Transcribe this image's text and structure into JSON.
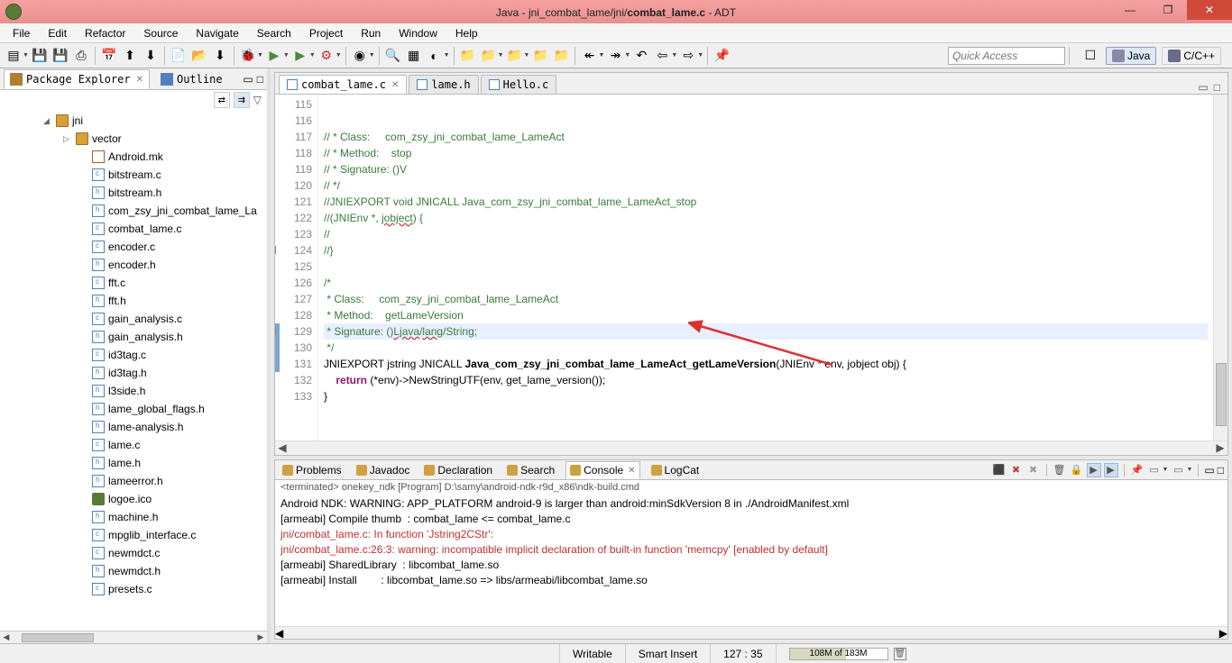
{
  "titlebar": {
    "title_prefix": "Java - jni_combat_lame/jni/",
    "title_file": "combat_lame.c",
    "title_suffix": " - ADT"
  },
  "menubar": [
    "File",
    "Edit",
    "Refactor",
    "Source",
    "Navigate",
    "Search",
    "Project",
    "Run",
    "Window",
    "Help"
  ],
  "toolbar": {
    "quick_access_placeholder": "Quick Access"
  },
  "perspectives": [
    {
      "label": "Java"
    },
    {
      "label": "C/C++"
    }
  ],
  "sidebar": {
    "tabs": [
      {
        "label": "Package Explorer",
        "active": true
      },
      {
        "label": "Outline",
        "active": false
      }
    ],
    "tree": {
      "root": "jni",
      "sub": "vector",
      "files": [
        {
          "name": "Android.mk",
          "type": "mk"
        },
        {
          "name": "bitstream.c",
          "type": "c"
        },
        {
          "name": "bitstream.h",
          "type": "h"
        },
        {
          "name": "com_zsy_jni_combat_lame_La",
          "type": "h"
        },
        {
          "name": "combat_lame.c",
          "type": "c"
        },
        {
          "name": "encoder.c",
          "type": "c"
        },
        {
          "name": "encoder.h",
          "type": "h"
        },
        {
          "name": "fft.c",
          "type": "c"
        },
        {
          "name": "fft.h",
          "type": "h"
        },
        {
          "name": "gain_analysis.c",
          "type": "c"
        },
        {
          "name": "gain_analysis.h",
          "type": "h"
        },
        {
          "name": "id3tag.c",
          "type": "c"
        },
        {
          "name": "id3tag.h",
          "type": "h"
        },
        {
          "name": "l3side.h",
          "type": "h"
        },
        {
          "name": "lame_global_flags.h",
          "type": "h"
        },
        {
          "name": "lame-analysis.h",
          "type": "h"
        },
        {
          "name": "lame.c",
          "type": "c"
        },
        {
          "name": "lame.h",
          "type": "h"
        },
        {
          "name": "lameerror.h",
          "type": "h"
        },
        {
          "name": "logoe.ico",
          "type": "ico"
        },
        {
          "name": "machine.h",
          "type": "h"
        },
        {
          "name": "mpglib_interface.c",
          "type": "c"
        },
        {
          "name": "newmdct.c",
          "type": "c"
        },
        {
          "name": "newmdct.h",
          "type": "h"
        },
        {
          "name": "presets.c",
          "type": "c"
        }
      ]
    }
  },
  "editor": {
    "tabs": [
      {
        "label": "combat_lame.c",
        "active": true,
        "dirty": false
      },
      {
        "label": "lame.h",
        "active": false
      },
      {
        "label": "Hello.c",
        "active": false
      }
    ],
    "first_line": 115,
    "lines": [
      {
        "n": 115,
        "html": "<span class='cmt'>// * Class:     com_zsy_jni_combat_lame_LameAct</span>"
      },
      {
        "n": 116,
        "html": "<span class='cmt'>// * Method:    stop</span>"
      },
      {
        "n": 117,
        "html": "<span class='cmt'>// * Signature: ()V</span>"
      },
      {
        "n": 118,
        "html": "<span class='cmt'>// */</span>"
      },
      {
        "n": 119,
        "html": "<span class='cmt'>//JNIEXPORT void JNICALL Java_com_zsy_jni_combat_lame_LameAct_stop</span>"
      },
      {
        "n": 120,
        "html": "<span class='cmt'>//(JNIEnv *, <span class='wavy'>jobject</span>) {</span>"
      },
      {
        "n": 121,
        "html": "<span class='cmt'>//</span>"
      },
      {
        "n": 122,
        "html": "<span class='cmt'>//}</span>"
      },
      {
        "n": 123,
        "html": ""
      },
      {
        "n": 124,
        "html": "<span class='cmt'>/*</span>",
        "fold": "-"
      },
      {
        "n": 125,
        "html": "<span class='cmt'> * Class:     com_zsy_jni_combat_lame_LameAct</span>"
      },
      {
        "n": 126,
        "html": "<span class='cmt'> * Method:    getLameVersion</span>"
      },
      {
        "n": 127,
        "html": "<span class='cmt'> * Signature: ()<span class='wavy'>Ljava</span>/<span class='wavy'>lang</span>/String;</span>",
        "hl": true
      },
      {
        "n": 128,
        "html": "<span class='cmt'> */</span>"
      },
      {
        "n": 129,
        "html": "JNIEXPORT jstring JNICALL <span class='fn'>Java_com_zsy_jni_combat_lame_LameAct_getLameVersion</span>(JNIEnv * env, jobject obj) {",
        "fold": "-",
        "changed": true
      },
      {
        "n": 130,
        "html": "    <span class='kw'>return</span> (*env)-&gt;NewStringUTF(env, get_lame_version());",
        "changed": true
      },
      {
        "n": 131,
        "html": "}",
        "changed": true
      },
      {
        "n": 132,
        "html": ""
      },
      {
        "n": 133,
        "html": ""
      }
    ]
  },
  "console": {
    "tabs": [
      {
        "label": "Problems",
        "icon": "problems-icon"
      },
      {
        "label": "Javadoc",
        "icon": "javadoc-icon"
      },
      {
        "label": "Declaration",
        "icon": "declaration-icon"
      },
      {
        "label": "Search",
        "icon": "search-icon"
      },
      {
        "label": "Console",
        "icon": "console-icon",
        "active": true
      },
      {
        "label": "LogCat",
        "icon": "logcat-icon"
      }
    ],
    "header": "<terminated> onekey_ndk [Program] D:\\samy\\android-ndk-r9d_x86\\ndk-build.cmd",
    "lines": [
      {
        "text": "Android NDK: WARNING: APP_PLATFORM android-9 is larger than android:minSdkVersion 8 in ./AndroidManifest.xml",
        "cls": ""
      },
      {
        "text": "[armeabi] Compile thumb  : combat_lame <= combat_lame.c",
        "cls": ""
      },
      {
        "text": "jni/combat_lame.c: In function 'Jstring2CStr':",
        "cls": "warn"
      },
      {
        "text": "jni/combat_lame.c:26:3: warning: incompatible implicit declaration of built-in function 'memcpy' [enabled by default]",
        "cls": "warn"
      },
      {
        "text": "[armeabi] SharedLibrary  : libcombat_lame.so",
        "cls": ""
      },
      {
        "text": "[armeabi] Install        : libcombat_lame.so => libs/armeabi/libcombat_lame.so",
        "cls": ""
      }
    ]
  },
  "statusbar": {
    "writable": "Writable",
    "insert": "Smart Insert",
    "cursor": "127 : 35",
    "heap": "108M of 183M"
  }
}
